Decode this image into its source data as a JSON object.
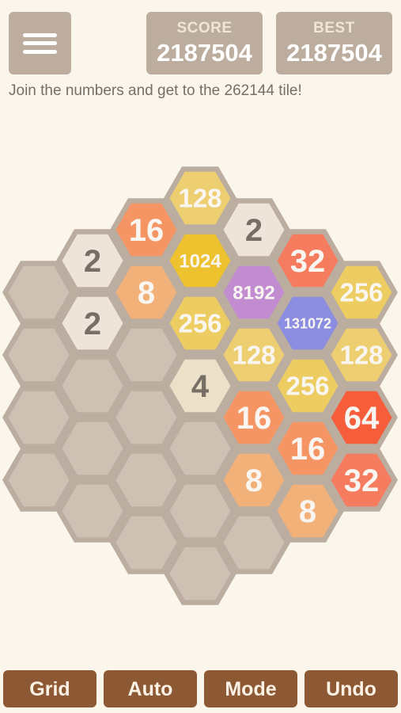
{
  "header": {
    "menu_icon": "hamburger-menu-icon",
    "score_label": "SCORE",
    "score_value": "2187504",
    "best_label": "BEST",
    "best_value": "2187504"
  },
  "tagline": "Join the numbers and get to the 262144 tile!",
  "board": {
    "tiles": [
      {
        "col": 0,
        "row": 0,
        "value": ""
      },
      {
        "col": 0,
        "row": 1,
        "value": ""
      },
      {
        "col": 0,
        "row": 2,
        "value": ""
      },
      {
        "col": 0,
        "row": 3,
        "value": ""
      },
      {
        "col": 1,
        "row": 0,
        "value": "2"
      },
      {
        "col": 1,
        "row": 1,
        "value": "2"
      },
      {
        "col": 1,
        "row": 2,
        "value": ""
      },
      {
        "col": 1,
        "row": 3,
        "value": ""
      },
      {
        "col": 1,
        "row": 4,
        "value": ""
      },
      {
        "col": 2,
        "row": 0,
        "value": "16"
      },
      {
        "col": 2,
        "row": 1,
        "value": "8"
      },
      {
        "col": 2,
        "row": 2,
        "value": ""
      },
      {
        "col": 2,
        "row": 3,
        "value": ""
      },
      {
        "col": 2,
        "row": 4,
        "value": ""
      },
      {
        "col": 2,
        "row": 5,
        "value": ""
      },
      {
        "col": 3,
        "row": 0,
        "value": "128"
      },
      {
        "col": 3,
        "row": 1,
        "value": "1024"
      },
      {
        "col": 3,
        "row": 2,
        "value": "256"
      },
      {
        "col": 3,
        "row": 3,
        "value": "4"
      },
      {
        "col": 3,
        "row": 4,
        "value": ""
      },
      {
        "col": 3,
        "row": 5,
        "value": ""
      },
      {
        "col": 3,
        "row": 6,
        "value": ""
      },
      {
        "col": 4,
        "row": 0,
        "value": "2"
      },
      {
        "col": 4,
        "row": 1,
        "value": "8192"
      },
      {
        "col": 4,
        "row": 2,
        "value": "128"
      },
      {
        "col": 4,
        "row": 3,
        "value": "16"
      },
      {
        "col": 4,
        "row": 4,
        "value": "8"
      },
      {
        "col": 4,
        "row": 5,
        "value": ""
      },
      {
        "col": 5,
        "row": 0,
        "value": "32"
      },
      {
        "col": 5,
        "row": 1,
        "value": "131072"
      },
      {
        "col": 5,
        "row": 2,
        "value": "256"
      },
      {
        "col": 5,
        "row": 3,
        "value": "16"
      },
      {
        "col": 5,
        "row": 4,
        "value": "8"
      },
      {
        "col": 6,
        "row": 0,
        "value": "256"
      },
      {
        "col": 6,
        "row": 1,
        "value": "128"
      },
      {
        "col": 6,
        "row": 2,
        "value": "64"
      },
      {
        "col": 6,
        "row": 3,
        "value": "32"
      }
    ],
    "colors": {
      "border": "#bbada0",
      "empty": "#cdc1b4",
      "2": "#eee4da",
      "4": "#ede0c8",
      "8": "#f2b179",
      "16": "#f59563",
      "32": "#f67c5f",
      "64": "#f65e3b",
      "128": "#edcf72",
      "256": "#edcc61",
      "1024": "#edc22e",
      "8192": "#c18dd0",
      "131072": "#8a8de0",
      "dark_text": "#776e65",
      "light_text": "#f9f6f2"
    }
  },
  "buttons": {
    "grid": "Grid",
    "auto": "Auto",
    "mode": "Mode",
    "undo": "Undo"
  }
}
